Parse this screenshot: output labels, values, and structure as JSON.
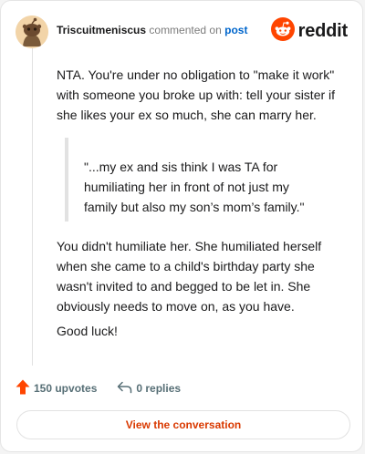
{
  "header": {
    "username": "Triscuitmeniscus",
    "action_text": "commented on",
    "post_link": "post",
    "brand_name": "reddit",
    "avatar_icon": "snoo-avatar-icon",
    "brand_icon": "reddit-logo-icon"
  },
  "comment": {
    "paragraph_1": "NTA. You're under no obligation to \"make it work\" with someone you broke up with: tell your sister if she likes your ex so much, she can marry her.",
    "quote": "\"...my ex and sis think I was TA for humiliating her in front of not just my family but also my son’s mom’s family.\"",
    "paragraph_2": "You didn't humiliate her. She humiliated herself when she came to a child's birthday party she wasn't invited to and begged to be let in. She obviously needs to move on, as you have.",
    "paragraph_3": "Good luck!"
  },
  "actions": {
    "upvotes": "150 upvotes",
    "replies": "0 replies",
    "upvote_icon": "upvote-arrow-icon",
    "reply_icon": "reply-arrow-icon"
  },
  "cta": {
    "label": "View the conversation"
  },
  "colors": {
    "brand_orange": "#ff4500",
    "link_blue": "#0066cc",
    "cta_text": "#d93900",
    "muted": "#576f76"
  }
}
